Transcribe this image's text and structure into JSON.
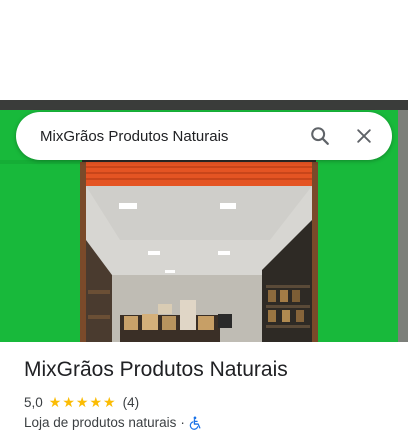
{
  "search": {
    "query": "MixGrãos Produtos Naturais",
    "search_icon": "search-icon",
    "close_icon": "close-icon"
  },
  "photo": {
    "description_icon": "storefront-photo"
  },
  "place": {
    "name": "MixGrãos Produtos Naturais",
    "rating_value": "5,0",
    "stars": 5,
    "review_count": "(4)",
    "category": "Loja de produtos naturais",
    "separator": "·",
    "accessibility_icon": "wheelchair-accessible-icon"
  },
  "colors": {
    "wall_green": "#17b83a",
    "shutter_orange": "#e8541e",
    "star_yellow": "#fbbc04",
    "accessible_blue": "#1a73e8"
  }
}
